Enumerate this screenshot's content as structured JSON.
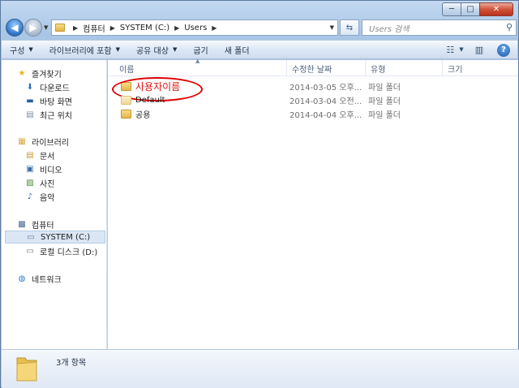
{
  "window": {
    "caption": {
      "minimize": "─",
      "maximize": "□",
      "close": "✕"
    }
  },
  "address": {
    "crumbs": [
      "컴퓨터",
      "SYSTEM (C:)",
      "Users"
    ],
    "search_placeholder": "Users 검색"
  },
  "toolbar": {
    "organize": "구성",
    "include_library": "라이브러리에 포함",
    "share": "공유 대상",
    "burn": "굽기",
    "new_folder": "새 폴더"
  },
  "nav": {
    "favorites": {
      "label": "즐겨찾기",
      "items": [
        "다운로드",
        "바탕 화면",
        "최근 위치"
      ]
    },
    "libraries": {
      "label": "라이브러리",
      "items": [
        "문서",
        "비디오",
        "사진",
        "음악"
      ]
    },
    "computer": {
      "label": "컴퓨터",
      "items": [
        "SYSTEM (C:)",
        "로컬 디스크 (D:)"
      ]
    },
    "network": {
      "label": "네트워크"
    }
  },
  "columns": {
    "name": "이름",
    "modified": "수정한 날짜",
    "type": "유형",
    "size": "크기"
  },
  "files": [
    {
      "name": "사용자이름",
      "modified": "2014-03-05 오후...",
      "type": "파일 폴더",
      "highlighted": true
    },
    {
      "name": "Default",
      "modified": "2014-03-04 오전...",
      "type": "파일 폴더",
      "highlighted": false
    },
    {
      "name": "공용",
      "modified": "2014-04-04 오후...",
      "type": "파일 폴더",
      "highlighted": false
    }
  ],
  "status": {
    "count": "3개 항목"
  },
  "colors": {
    "highlight_ring": "#e00000",
    "selected_nav": "#dbe6f4",
    "accent": "#2a6fc2"
  }
}
